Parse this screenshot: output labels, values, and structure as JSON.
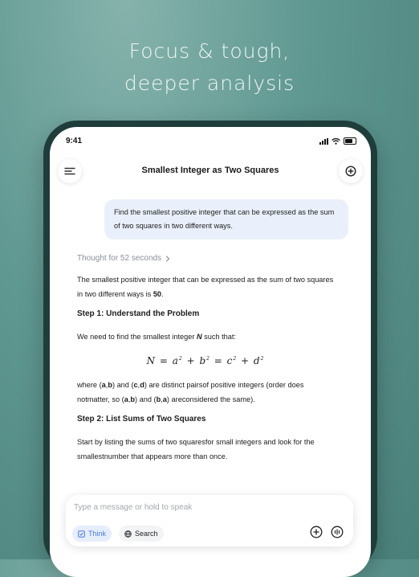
{
  "promo": {
    "line1": "Focus & tough,",
    "line2": "deeper analysis"
  },
  "status_bar": {
    "time": "9:41"
  },
  "header": {
    "title": "Smallest Integer as Two Squares",
    "menu_icon": "menu-icon",
    "new_chat_icon": "new-chat-icon"
  },
  "user_message": "Find the smallest positive integer that can be expressed as the sum of two squares in two different ways.",
  "response": {
    "thought_label": "Thought for 52 seconds",
    "intro_pre": "The smallest positive integer that can be expressed as the sum of two squares in two different ways is ",
    "intro_answer": "50",
    "intro_post": ".",
    "step1_heading": "Step 1: Understand the Problem",
    "step1_pre": "We need to find the smallest integer ",
    "step1_var": "N",
    "step1_post": " such that:",
    "equation": {
      "lhs": "N",
      "eq1": " = ",
      "t1": "a",
      "plus1": " + ",
      "t2": "b",
      "eq2": " = ",
      "t3": "c",
      "plus2": " + ",
      "t4": "d",
      "exp": "2"
    },
    "where": {
      "p1": "where (",
      "a": "a",
      "comma1": ",",
      "b": "b",
      "p2": ") and (",
      "c": "c",
      "comma2": ",",
      "d": "d",
      "p3": ") are distinct pairsof positive integers (order does notmatter, so (",
      "a2": "a",
      "comma3": ",",
      "b2": "b",
      "p4": ") and (",
      "b3": "b",
      "comma4": ",",
      "a3": "a",
      "p5": ") areconsidered the same)."
    },
    "step2_heading": "Step 2: List Sums of Two Squares",
    "step2_text": "Start by listing the sums of two squaresfor small integers and look for the smallestnumber that appears more than once."
  },
  "composer": {
    "placeholder": "Type a message or hold to speak",
    "think_label": "Think",
    "search_label": "Search",
    "think_active": true
  },
  "colors": {
    "accent": "#4a7be0",
    "think_chip_bg": "#e6eefc",
    "user_bubble_bg": "#eaf0fb",
    "background": "#5f9891"
  }
}
